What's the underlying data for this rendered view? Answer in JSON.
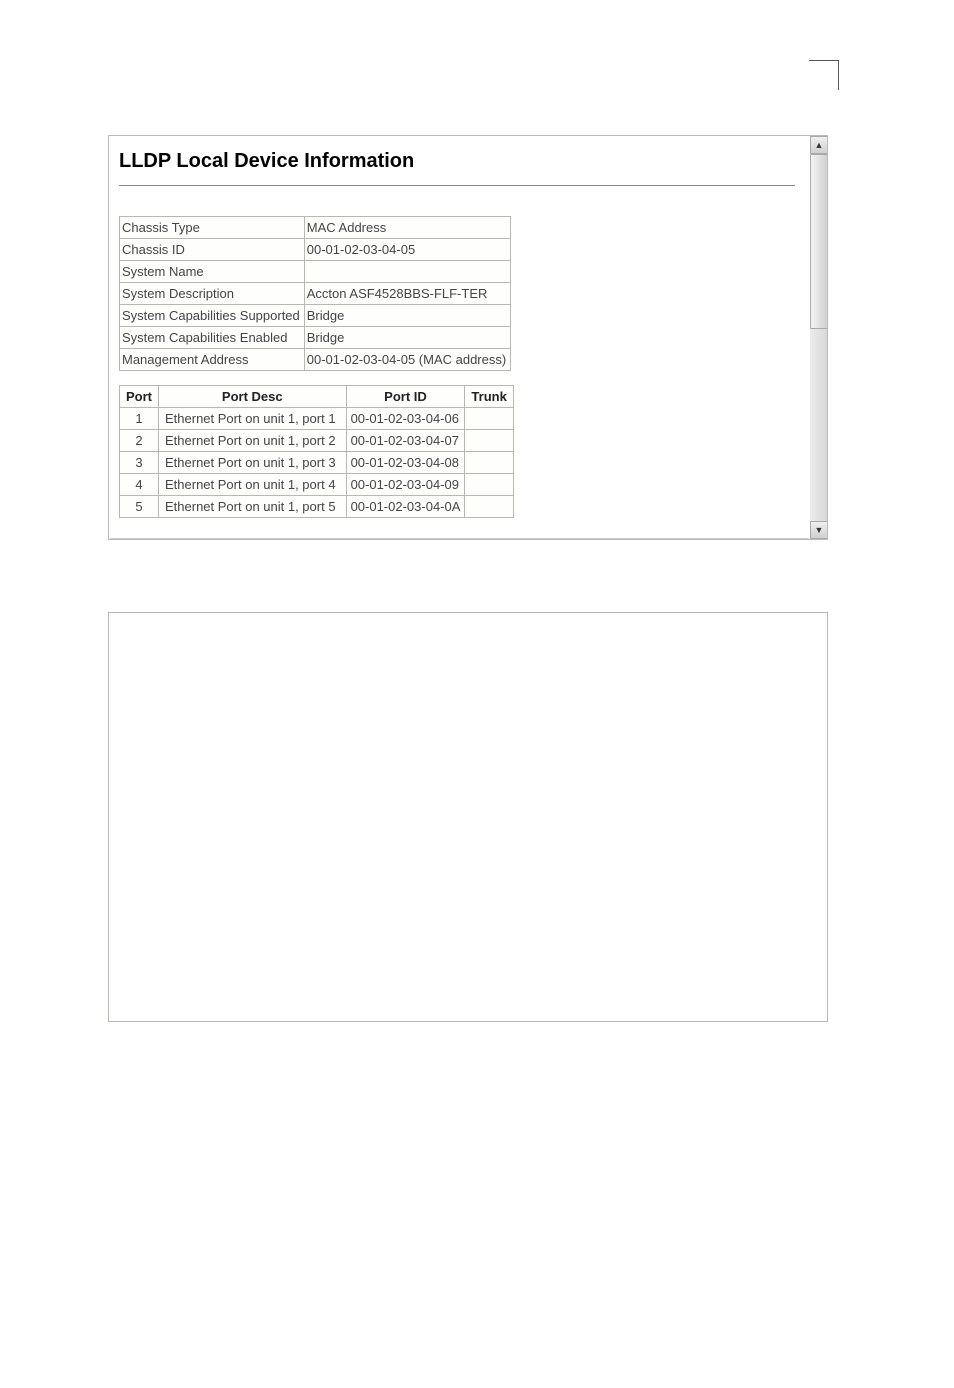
{
  "title": "LLDP Local Device Information",
  "info_rows": [
    {
      "label": "Chassis Type",
      "value": "MAC Address"
    },
    {
      "label": "Chassis ID",
      "value": "00-01-02-03-04-05"
    },
    {
      "label": "System Name",
      "value": ""
    },
    {
      "label": "System Description",
      "value": "Accton ASF4528BBS-FLF-TER"
    },
    {
      "label": "System Capabilities Supported",
      "value": "Bridge"
    },
    {
      "label": "System Capabilities Enabled",
      "value": "Bridge"
    },
    {
      "label": "Management Address",
      "value": "00-01-02-03-04-05 (MAC address)"
    }
  ],
  "port_headers": {
    "port": "Port",
    "desc": "Port Desc",
    "id": "Port ID",
    "trunk": "Trunk"
  },
  "port_rows": [
    {
      "port": "1",
      "desc": "Ethernet Port on unit 1, port 1",
      "id": "00-01-02-03-04-06",
      "trunk": ""
    },
    {
      "port": "2",
      "desc": "Ethernet Port on unit 1, port 2",
      "id": "00-01-02-03-04-07",
      "trunk": ""
    },
    {
      "port": "3",
      "desc": "Ethernet Port on unit 1, port 3",
      "id": "00-01-02-03-04-08",
      "trunk": ""
    },
    {
      "port": "4",
      "desc": "Ethernet Port on unit 1, port 4",
      "id": "00-01-02-03-04-09",
      "trunk": ""
    },
    {
      "port": "5",
      "desc": "Ethernet Port on unit 1, port 5",
      "id": "00-01-02-03-04-0A",
      "trunk": ""
    }
  ]
}
